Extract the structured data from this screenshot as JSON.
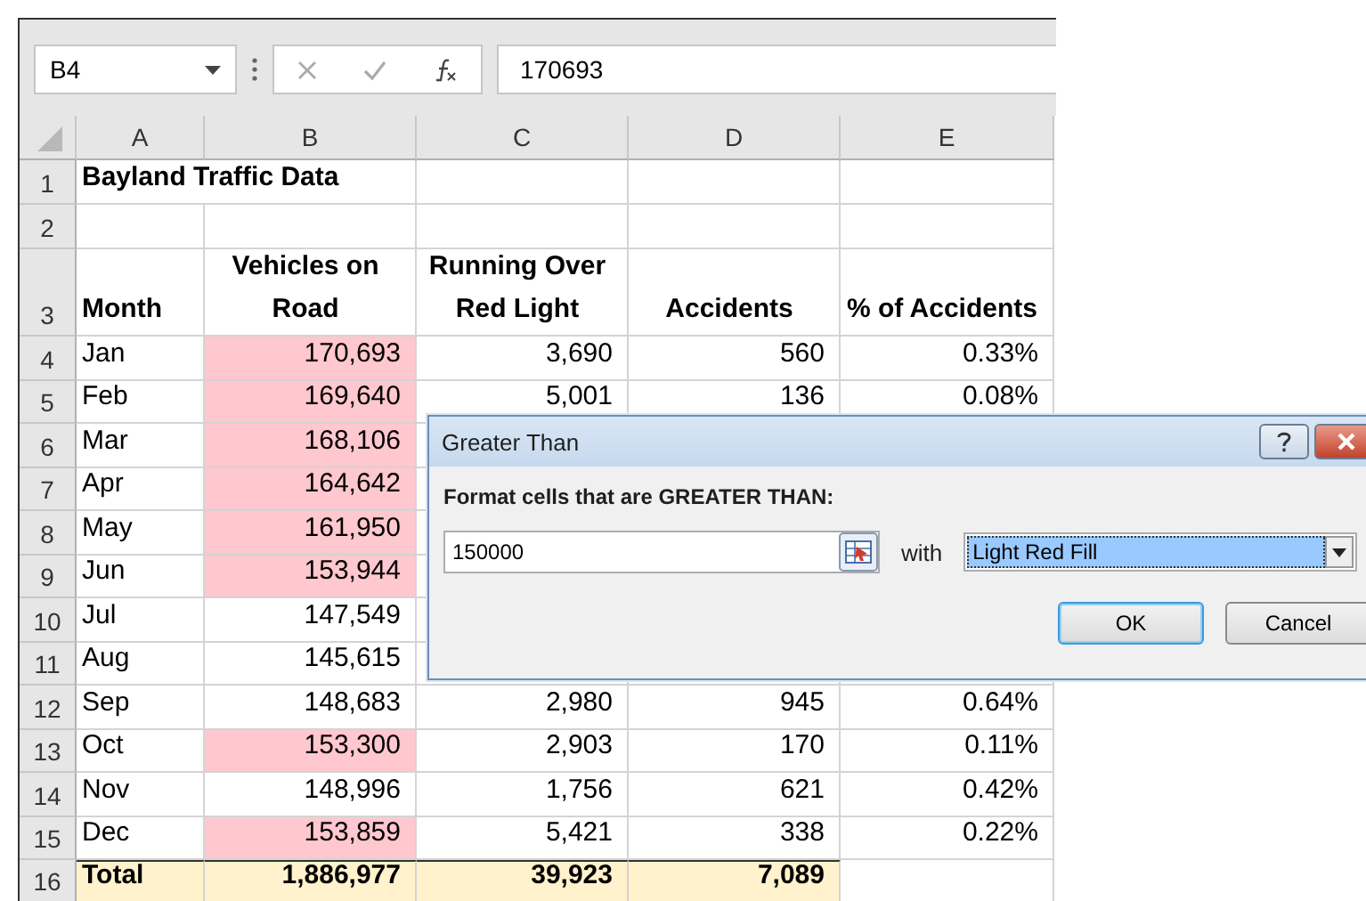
{
  "formula_bar": {
    "name_box": "B4",
    "formula": "170693"
  },
  "columns": [
    "A",
    "B",
    "C",
    "D",
    "E"
  ],
  "rows": [
    {
      "num": "1",
      "kind": "title",
      "cells": [
        "Bayland Traffic Data"
      ]
    },
    {
      "num": "2",
      "kind": "blank",
      "cells": []
    },
    {
      "num": "3",
      "kind": "header",
      "cells": [
        "Month",
        "Vehicles on Road",
        "Running Over Red Light",
        "Accidents",
        "% of Accidents"
      ]
    },
    {
      "num": "4",
      "kind": "data",
      "highlight": true,
      "cells": [
        "Jan",
        "170,693",
        "3,690",
        "560",
        "0.33%"
      ]
    },
    {
      "num": "5",
      "kind": "data",
      "highlight": true,
      "cells": [
        "Feb",
        "169,640",
        "5,001",
        "136",
        "0.08%"
      ]
    },
    {
      "num": "6",
      "kind": "data",
      "highlight": true,
      "cells": [
        "Mar",
        "168,106"
      ]
    },
    {
      "num": "7",
      "kind": "data",
      "highlight": true,
      "cells": [
        "Apr",
        "164,642"
      ]
    },
    {
      "num": "8",
      "kind": "data",
      "highlight": true,
      "cells": [
        "May",
        "161,950"
      ]
    },
    {
      "num": "9",
      "kind": "data",
      "highlight": true,
      "cells": [
        "Jun",
        "153,944"
      ]
    },
    {
      "num": "10",
      "kind": "data",
      "highlight": false,
      "cells": [
        "Jul",
        "147,549"
      ]
    },
    {
      "num": "11",
      "kind": "data",
      "highlight": false,
      "cells": [
        "Aug",
        "145,615"
      ]
    },
    {
      "num": "12",
      "kind": "data",
      "highlight": false,
      "cells": [
        "Sep",
        "148,683",
        "2,980",
        "945",
        "0.64%"
      ]
    },
    {
      "num": "13",
      "kind": "data",
      "highlight": true,
      "cells": [
        "Oct",
        "153,300",
        "2,903",
        "170",
        "0.11%"
      ]
    },
    {
      "num": "14",
      "kind": "data",
      "highlight": false,
      "cells": [
        "Nov",
        "148,996",
        "1,756",
        "621",
        "0.42%"
      ]
    },
    {
      "num": "15",
      "kind": "data",
      "highlight": true,
      "cells": [
        "Dec",
        "153,859",
        "5,421",
        "338",
        "0.22%"
      ]
    },
    {
      "num": "16",
      "kind": "total",
      "cells": [
        "Total",
        "1,886,977",
        "39,923",
        "7,089"
      ]
    }
  ],
  "dialog": {
    "title": "Greater Than",
    "prompt": "Format cells that are GREATER THAN:",
    "value": "150000",
    "with_label": "with",
    "format": "Light Red Fill",
    "buttons": [
      {
        "label": "OK",
        "focused": true
      },
      {
        "label": "Cancel",
        "focused": false
      }
    ]
  }
}
